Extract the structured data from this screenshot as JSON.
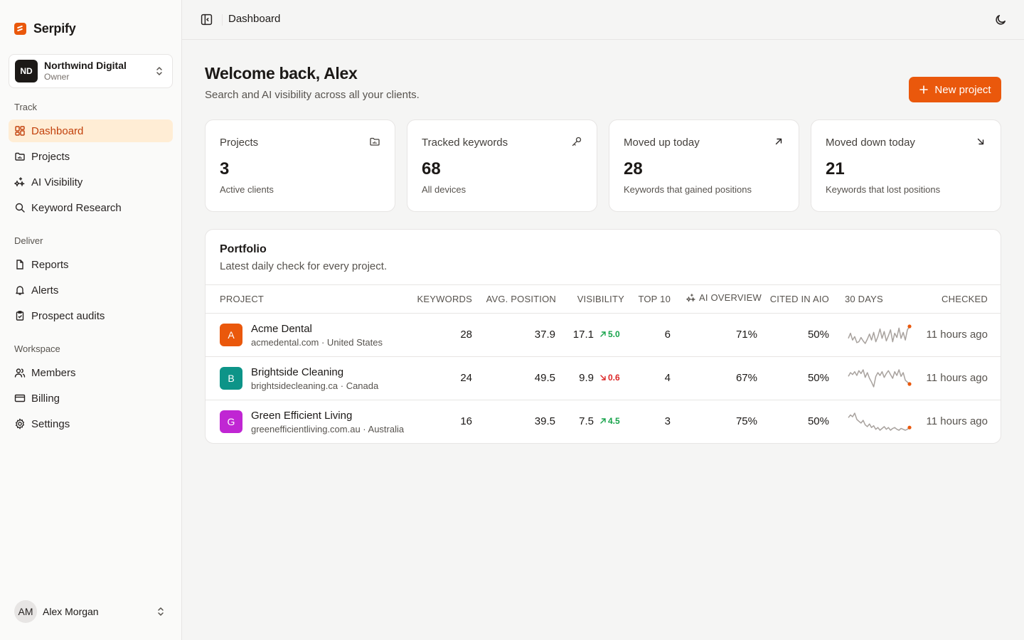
{
  "brand": {
    "name": "Serpify"
  },
  "org": {
    "initials": "ND",
    "name": "Northwind Digital",
    "role": "Owner"
  },
  "nav": {
    "track_title": "Track",
    "track": [
      {
        "label": "Dashboard",
        "icon": "layout-dashboard-icon"
      },
      {
        "label": "Projects",
        "icon": "folder-icon"
      },
      {
        "label": "AI Visibility",
        "icon": "sparkles-icon"
      },
      {
        "label": "Keyword Research",
        "icon": "search-icon"
      }
    ],
    "deliver_title": "Deliver",
    "deliver": [
      {
        "label": "Reports",
        "icon": "file-icon"
      },
      {
        "label": "Alerts",
        "icon": "bell-icon"
      },
      {
        "label": "Prospect audits",
        "icon": "clipboard-icon"
      }
    ],
    "workspace_title": "Workspace",
    "workspace": [
      {
        "label": "Members",
        "icon": "users-icon"
      },
      {
        "label": "Billing",
        "icon": "credit-card-icon"
      },
      {
        "label": "Settings",
        "icon": "gear-icon"
      }
    ]
  },
  "user": {
    "initials": "AM",
    "name": "Alex Morgan"
  },
  "topbar": {
    "title": "Dashboard"
  },
  "header": {
    "welcome": "Welcome back, Alex",
    "subtitle": "Search and AI visibility across all your clients.",
    "new_project": "New project"
  },
  "stats": [
    {
      "label": "Projects",
      "value": "3",
      "sub": "Active clients",
      "icon": "folder-icon"
    },
    {
      "label": "Tracked keywords",
      "value": "68",
      "sub": "All devices",
      "icon": "key-icon"
    },
    {
      "label": "Moved up today",
      "value": "28",
      "sub": "Keywords that gained positions",
      "icon": "arrow-up-right-icon"
    },
    {
      "label": "Moved down today",
      "value": "21",
      "sub": "Keywords that lost positions",
      "icon": "arrow-down-right-icon"
    }
  ],
  "portfolio": {
    "title": "Portfolio",
    "subtitle": "Latest daily check for every project.",
    "columns": {
      "project": "PROJECT",
      "keywords": "KEYWORDS",
      "avg_position": "AVG. POSITION",
      "visibility": "VISIBILITY",
      "top10": "TOP 10",
      "ai_overview": "AI OVERVIEW",
      "cited": "CITED IN AIO",
      "days30": "30 DAYS",
      "checked": "CHECKED"
    },
    "rows": [
      {
        "initial": "A",
        "color": "#ea580c",
        "name": "Acme Dental",
        "domain": "acmedental.com · United States",
        "keywords": "28",
        "avg_position": "37.9",
        "visibility": "17.1",
        "delta": "5.0",
        "delta_dir": "up",
        "top10": "6",
        "ai_overview": "71%",
        "cited": "50%",
        "checked": "11 hours ago",
        "trend": [
          20,
          14,
          22,
          18,
          25,
          24,
          19,
          23,
          26,
          21,
          15,
          22,
          13,
          24,
          18,
          9,
          20,
          12,
          23,
          17,
          10,
          24,
          14,
          19,
          8,
          20,
          13,
          22,
          10,
          6
        ]
      },
      {
        "initial": "B",
        "color": "#0d9488",
        "name": "Brightside Cleaning",
        "domain": "brightsidecleaning.ca · Canada",
        "keywords": "24",
        "avg_position": "49.5",
        "visibility": "9.9",
        "delta": "0.6",
        "delta_dir": "down",
        "top10": "4",
        "ai_overview": "67%",
        "cited": "50%",
        "checked": "11 hours ago",
        "trend": [
          14,
          10,
          12,
          9,
          13,
          8,
          11,
          7,
          15,
          10,
          16,
          20,
          25,
          14,
          10,
          13,
          9,
          15,
          11,
          8,
          12,
          16,
          9,
          13,
          7,
          14,
          10,
          18,
          20,
          22
        ]
      },
      {
        "initial": "G",
        "color": "#c026d3",
        "name": "Green Efficient Living",
        "domain": "greenefficientliving.com.au · Australia",
        "keywords": "16",
        "avg_position": "39.5",
        "visibility": "7.5",
        "delta": "4.5",
        "delta_dir": "up",
        "top10": "3",
        "ai_overview": "75%",
        "cited": "50%",
        "checked": "11 hours ago",
        "trend": [
          10,
          7,
          9,
          5,
          12,
          14,
          16,
          13,
          18,
          20,
          17,
          21,
          19,
          23,
          21,
          24,
          22,
          20,
          23,
          21,
          24,
          22,
          21,
          23,
          24,
          22,
          23,
          24,
          23,
          21
        ]
      }
    ]
  }
}
